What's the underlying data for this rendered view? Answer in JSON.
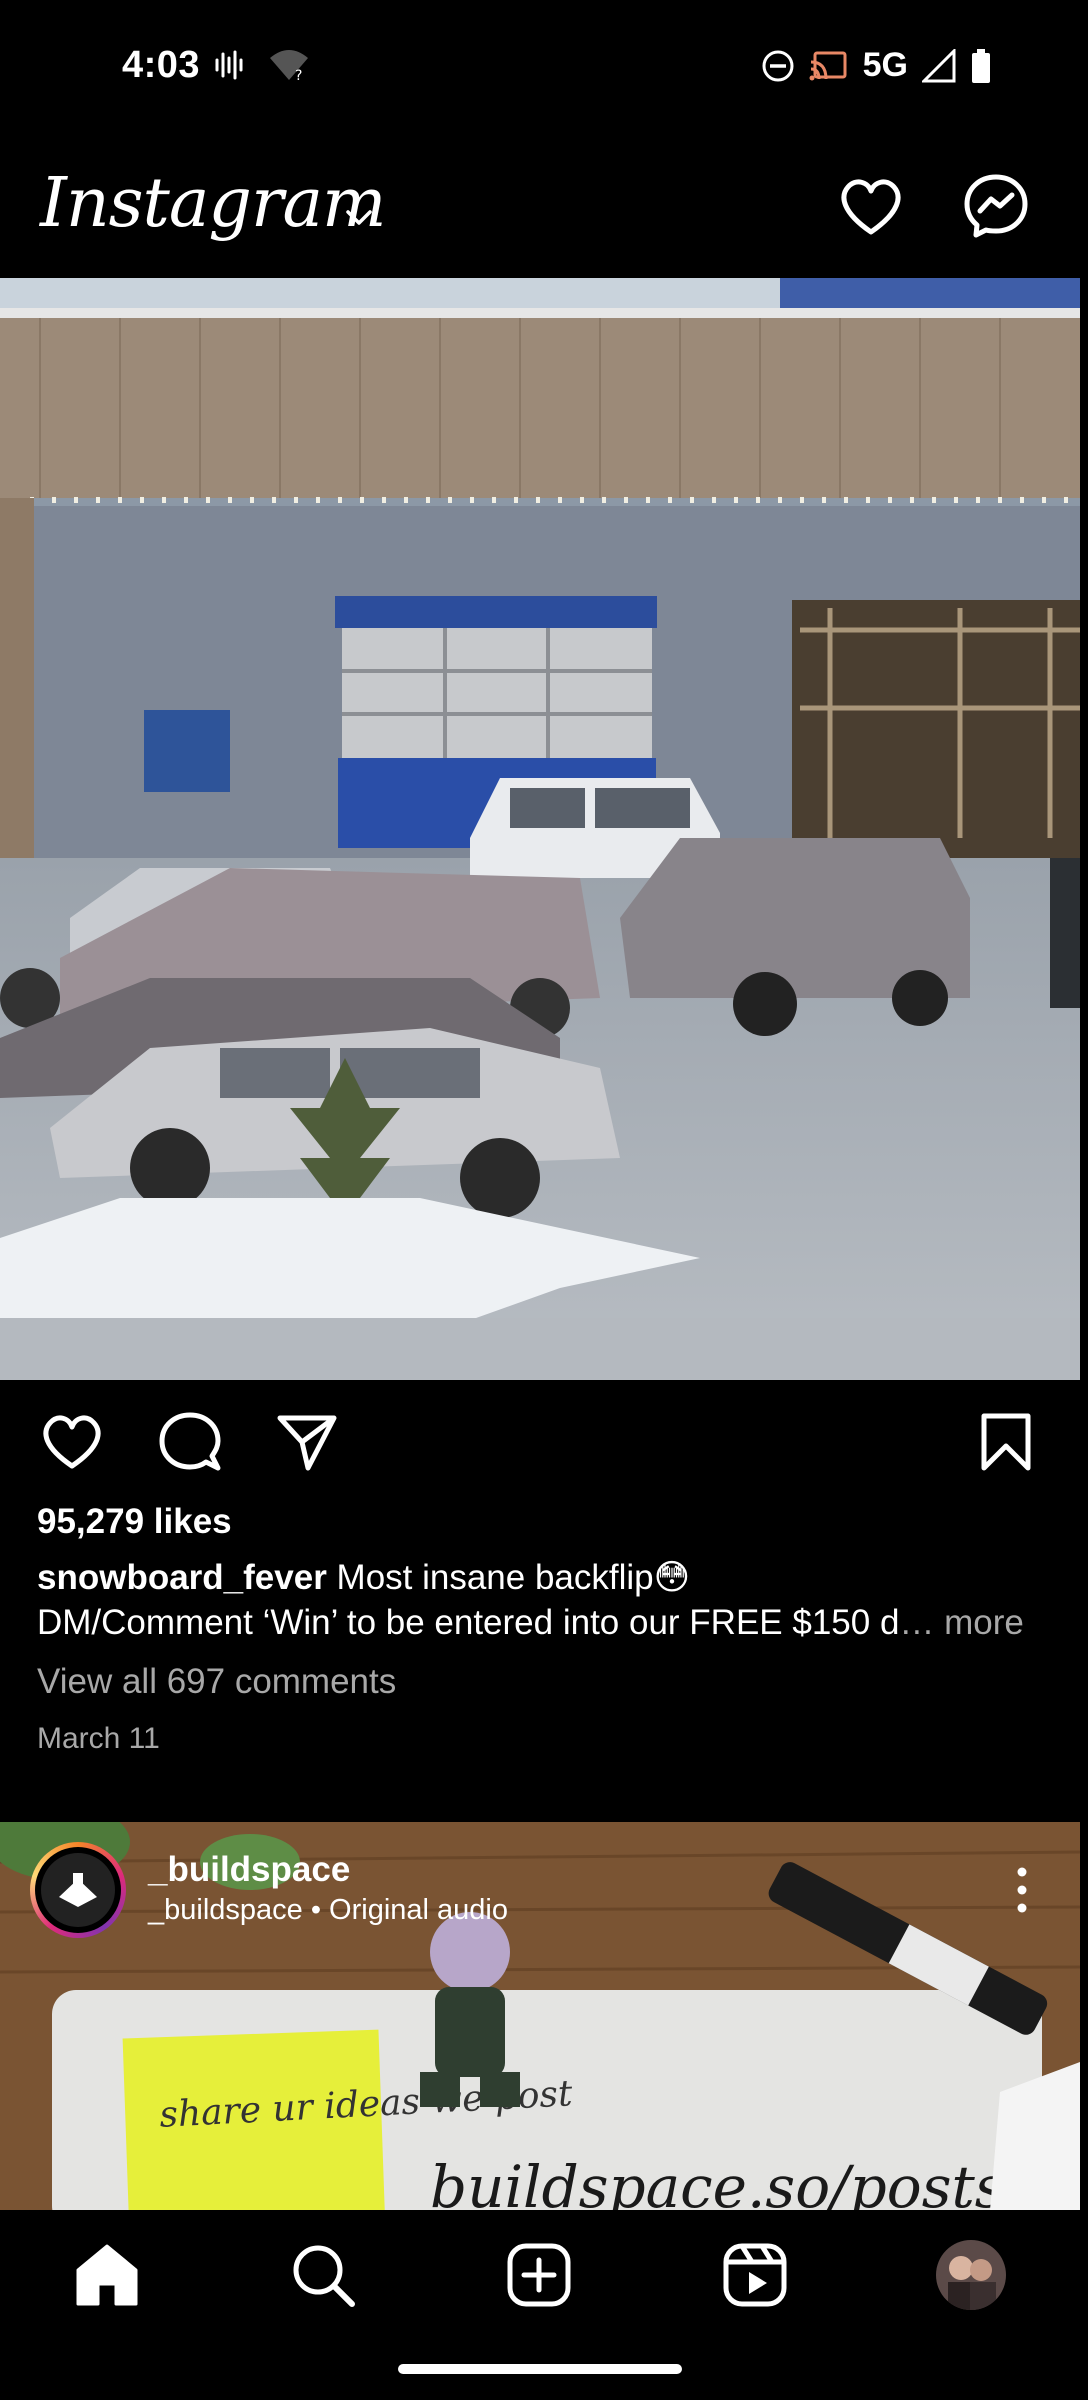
{
  "status_bar": {
    "time": "4:03",
    "network": "5G",
    "icons_left": [
      "voicemail-wave-icon",
      "wifi-question-icon"
    ],
    "icons_right": [
      "do-not-disturb-icon",
      "cast-icon",
      "signal-icon",
      "battery-icon"
    ]
  },
  "header": {
    "logo": "Instagram",
    "icons": [
      "chevron-down-icon",
      "heart-icon",
      "messenger-icon"
    ]
  },
  "post1": {
    "media_alt": "video frame of parking lot with cars on ice",
    "likes": "95,279 likes",
    "username": "snowboard_fever",
    "caption_text": " Most insane backflip😳",
    "caption_line2": "DM/Comment ‘Win’ to be entered into our FREE $150 d",
    "ellipsis": "…",
    "more": " more",
    "view_comments": "View all 697 comments",
    "date": "March 11",
    "action_icons": [
      "like-icon",
      "comment-icon",
      "share-icon",
      "bookmark-icon"
    ]
  },
  "post2": {
    "username": "_buildspace",
    "audio": "_buildspace • Original audio",
    "sticky_note": "share ur ideas we post",
    "board_text": "buildspace.so/posts"
  },
  "bottom_nav": {
    "items": [
      "home-icon",
      "search-icon",
      "create-icon",
      "reels-icon",
      "profile-avatar"
    ]
  },
  "colors": {
    "background": "#000000",
    "secondary_text": "#a8a8a8",
    "text": "#ffffff"
  }
}
